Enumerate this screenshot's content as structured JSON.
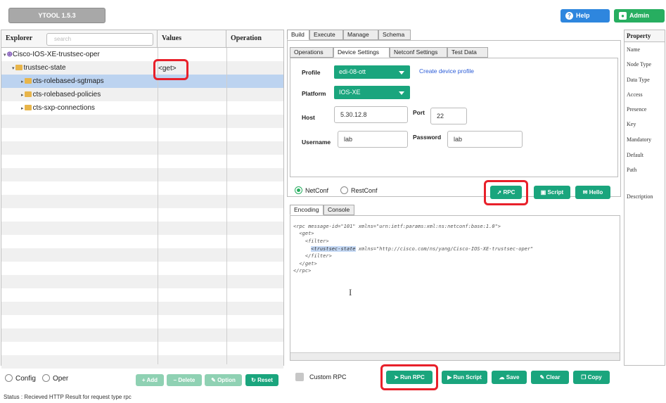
{
  "app": {
    "title": "YTOOL 1.5.3"
  },
  "header": {
    "help_label": "Help",
    "admin_label": "Admin"
  },
  "explorer": {
    "columns": [
      "Explorer",
      "Values",
      "Operation"
    ],
    "search_placeholder": "search",
    "tree": [
      {
        "label": "Cisco-IOS-XE-trustsec-oper",
        "level": 0
      },
      {
        "label": "trustsec-state",
        "level": 1,
        "value": "<get>"
      },
      {
        "label": "cts-rolebased-sgtmaps",
        "level": 2,
        "selected": true
      },
      {
        "label": "cts-rolebased-policies",
        "level": 2
      },
      {
        "label": "cts-sxp-connections",
        "level": 2
      }
    ],
    "footer": {
      "config_label": "Config",
      "oper_label": "Oper",
      "add_label": "Add",
      "delete_label": "Delete",
      "option_label": "Option",
      "reset_label": "Reset"
    }
  },
  "status": {
    "text": "Status : Recieved HTTP Result for request type rpc"
  },
  "main_tabs": [
    "Build",
    "Execute",
    "Manage",
    "Schema"
  ],
  "sub_tabs": [
    "Operations",
    "Device Settings",
    "Netconf Settings",
    "Test Data"
  ],
  "device": {
    "profile_label": "Profile",
    "profile_value": "edi-08-ott",
    "create_link": "Create device profile",
    "platform_label": "Platform",
    "platform_value": "IOS-XE",
    "host_label": "Host",
    "host_value": "5.30.12.8",
    "port_label": "Port",
    "port_value": "22",
    "username_label": "Username",
    "username_value": "lab",
    "password_label": "Password",
    "password_value": "lab"
  },
  "protocol": {
    "netconf_label": "NetConf",
    "restconf_label": "RestConf",
    "rpc_label": "RPC",
    "script_label": "Script",
    "hello_label": "Hello"
  },
  "editor": {
    "tabs": [
      "Encoding",
      "Console"
    ],
    "lines": [
      "<rpc message-id=\"101\" xmlns=\"urn:ietf:params:xml:ns:netconf:base:1.0\">",
      "  <get>",
      "    <filter>",
      "      ",
      "    </filter>",
      "  </get>",
      "</rpc>"
    ],
    "highlight_tag": "<trustsec-state",
    "highlight_rest": " xmlns=\"http://cisco.com/ns/yang/Cisco-IOS-XE-trustsec-oper\""
  },
  "actions": {
    "custom_rpc_label": "Custom RPC",
    "run_rpc_label": "Run RPC",
    "run_script_label": "Run Script",
    "save_label": "Save",
    "clear_label": "Clear",
    "copy_label": "Copy"
  },
  "property": {
    "header": "Property",
    "items": [
      "Name",
      "Node Type",
      "Data Type",
      "Access",
      "Presence",
      "Key",
      "Mandatory",
      "Default",
      "Path",
      "Description"
    ]
  },
  "colors": {
    "accent_green": "#1aa57d",
    "help_blue": "#2e86de",
    "admin_green": "#27ae60",
    "highlight_red": "#e8202a"
  }
}
